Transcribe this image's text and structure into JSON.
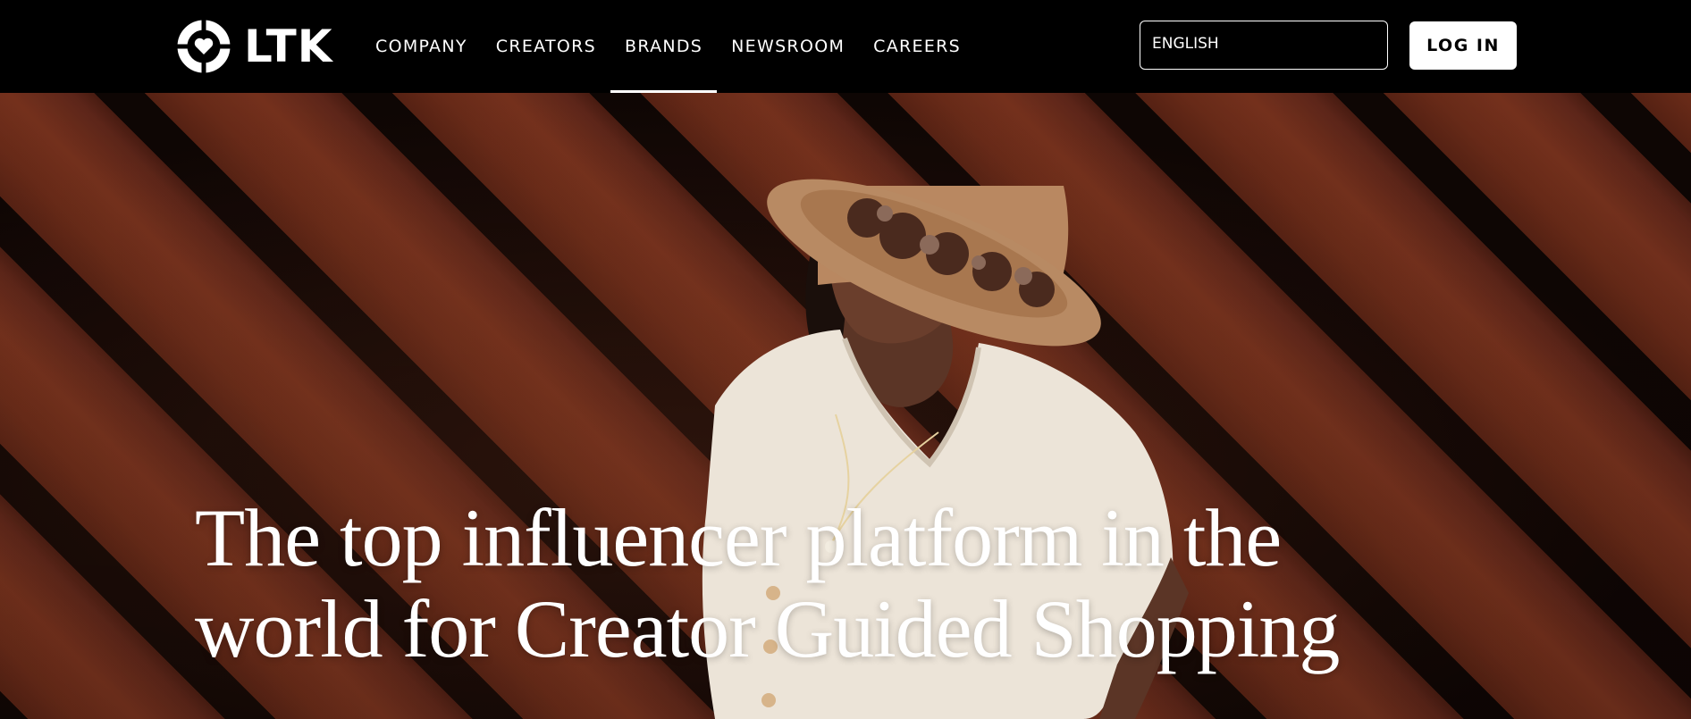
{
  "logo": {
    "text": "LTK",
    "icon": "ltk-heart-ring-logo"
  },
  "nav": {
    "links": [
      {
        "label": "COMPANY",
        "active": false
      },
      {
        "label": "CREATORS",
        "active": false
      },
      {
        "label": "BRANDS",
        "active": true
      },
      {
        "label": "NEWSROOM",
        "active": false
      },
      {
        "label": "CAREERS",
        "active": false
      }
    ]
  },
  "language_select": {
    "value": "ENGLISH"
  },
  "login": {
    "label": "LOG IN"
  },
  "hero": {
    "headline_line1": "The top influencer platform in the",
    "headline_line2": "world for Creator Guided Shopping",
    "image": "woman-in-straw-hat-photo"
  },
  "colors": {
    "nav_bg": "#000000",
    "text": "#ffffff",
    "wood": "#6d2c19",
    "button_bg": "#ffffff"
  }
}
